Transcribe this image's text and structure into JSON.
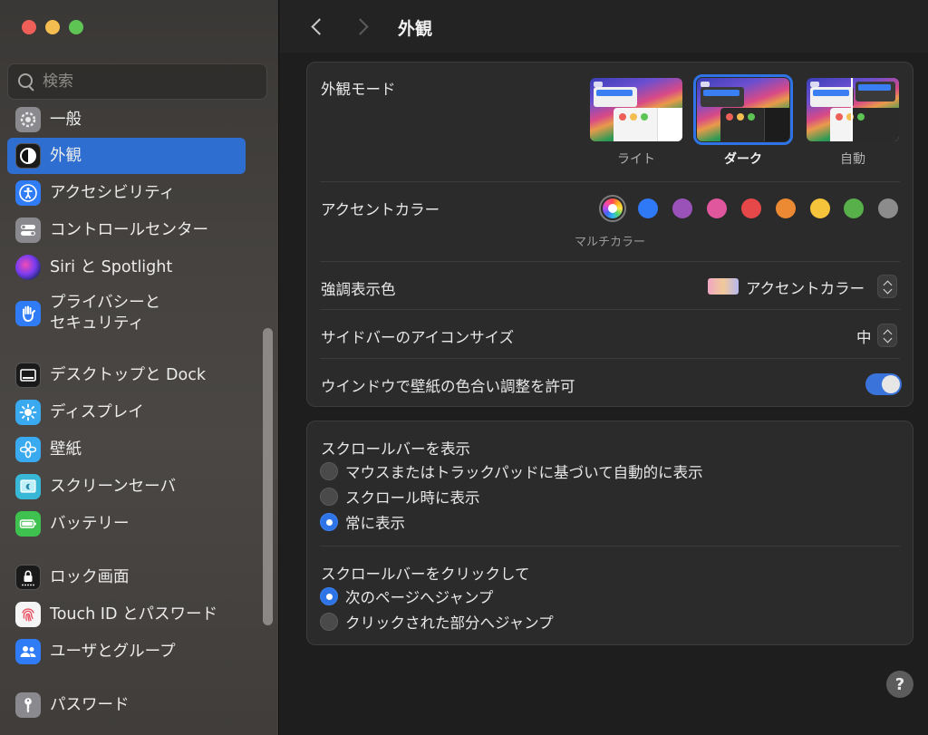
{
  "window": {
    "title": "外観"
  },
  "sidebar": {
    "search_placeholder": "検索",
    "items": [
      {
        "label": "一般",
        "icon": "gear-icon"
      },
      {
        "label": "外観",
        "icon": "appearance-icon",
        "selected": true
      },
      {
        "label": "アクセシビリティ",
        "icon": "accessibility-icon"
      },
      {
        "label": "コントロールセンター",
        "icon": "control-center-icon"
      },
      {
        "label": "Siri と Spotlight",
        "icon": "siri-icon"
      },
      {
        "label": "プライバシーと\nセキュリティ",
        "line1": "プライバシーと",
        "line2": "セキュリティ",
        "icon": "hand-icon"
      },
      {
        "label": "デスクトップと Dock",
        "icon": "desktop-dock-icon"
      },
      {
        "label": "ディスプレイ",
        "icon": "sun-icon"
      },
      {
        "label": "壁紙",
        "icon": "flower-icon"
      },
      {
        "label": "スクリーンセーバ",
        "icon": "screensaver-icon"
      },
      {
        "label": "バッテリー",
        "icon": "battery-icon"
      },
      {
        "label": "ロック画面",
        "icon": "lock-icon"
      },
      {
        "label": "Touch ID とパスワード",
        "icon": "fingerprint-icon"
      },
      {
        "label": "ユーザとグループ",
        "icon": "users-icon"
      },
      {
        "label": "パスワード",
        "icon": "key-icon"
      }
    ]
  },
  "appearance": {
    "mode_label": "外観モード",
    "modes": [
      {
        "label": "ライト",
        "selected": false
      },
      {
        "label": "ダーク",
        "selected": true
      },
      {
        "label": "自動",
        "selected": false
      }
    ],
    "accent_label": "アクセントカラー",
    "accent_caption": "マルチカラー",
    "accent_colors": [
      "multicolor",
      "#2f78f6",
      "#9a52b8",
      "#e0579e",
      "#e6484a",
      "#ec8a33",
      "#f6c43a",
      "#58b04a",
      "#8c8c8c"
    ],
    "highlight_label": "強調表示色",
    "highlight_value": "アクセントカラー",
    "sidebar_icon_size_label": "サイドバーのアイコンサイズ",
    "sidebar_icon_size_value": "中",
    "tint_label": "ウインドウで壁紙の色合い調整を許可",
    "tint_enabled": true
  },
  "scrollbars": {
    "show_label": "スクロールバーを表示",
    "show_options": [
      {
        "label": "マウスまたはトラックパッドに基づいて自動的に表示",
        "selected": false
      },
      {
        "label": "スクロール時に表示",
        "selected": false
      },
      {
        "label": "常に表示",
        "selected": true
      }
    ],
    "click_label": "スクロールバーをクリックして",
    "click_options": [
      {
        "label": "次のページへジャンプ",
        "selected": true
      },
      {
        "label": "クリックされた部分へジャンプ",
        "selected": false
      }
    ]
  },
  "help": {
    "label": "?"
  }
}
